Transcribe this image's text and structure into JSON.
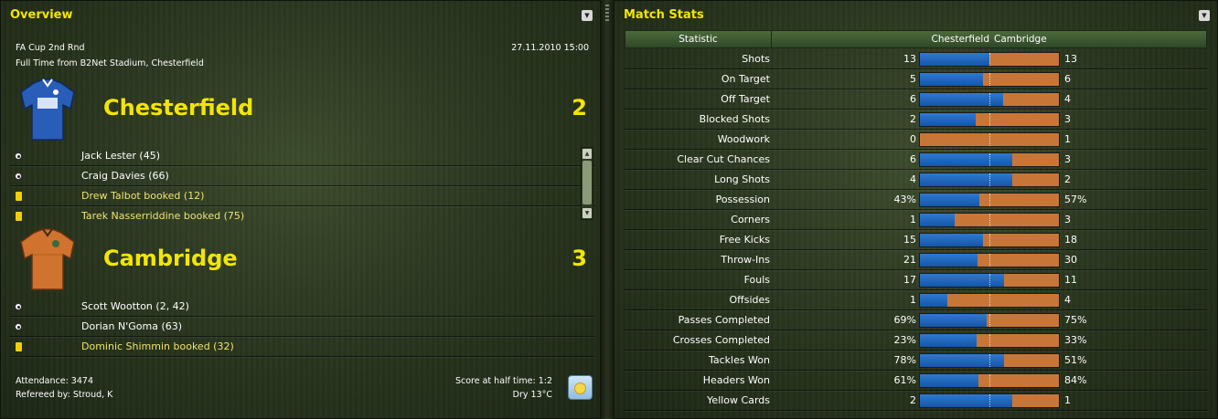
{
  "overview": {
    "title": "Overview",
    "competition": "FA Cup 2nd Rnd",
    "datetime": "27.11.2010 15:00",
    "venue_line": "Full Time from B2Net Stadium, Chesterfield",
    "home": {
      "name": "Chesterfield",
      "score": "2",
      "kit_color": "#2a5db8",
      "events": [
        {
          "type": "goal",
          "icon": "ball-icon",
          "text": "Jack Lester (45)"
        },
        {
          "type": "goal",
          "icon": "ball-icon",
          "text": "Craig Davies (66)"
        },
        {
          "type": "booking",
          "icon": "yellow-card-icon",
          "text": "Drew Talbot booked (12)"
        },
        {
          "type": "booking",
          "icon": "yellow-card-icon",
          "text": "Tarek Nasserriddine booked (75)"
        }
      ]
    },
    "away": {
      "name": "Cambridge",
      "score": "3",
      "kit_color": "#d0732e",
      "events": [
        {
          "type": "goal",
          "icon": "ball-icon",
          "text": "Scott Wootton (2, 42)"
        },
        {
          "type": "goal",
          "icon": "ball-icon",
          "text": "Dorian N'Goma (63)"
        },
        {
          "type": "booking",
          "icon": "yellow-card-icon",
          "text": "Dominic Shimmin booked (32)"
        }
      ]
    },
    "attendance": "Attendance: 3474",
    "referee": "Refereed by: Stroud, K",
    "halftime": "Score at half time: 1:2",
    "weather": "Dry 13°C",
    "weather_icon": "sun-icon"
  },
  "stats": {
    "title": "Match Stats",
    "columns": {
      "statistic": "Statistic",
      "home": "Chesterfield",
      "away": "Cambridge"
    },
    "colors": {
      "home": "#1e63be",
      "away": "#c87637"
    },
    "rows": [
      {
        "label": "Shots",
        "home": "13",
        "away": "13",
        "home_share": 0.5
      },
      {
        "label": "On Target",
        "home": "5",
        "away": "6",
        "home_share": 0.455
      },
      {
        "label": "Off Target",
        "home": "6",
        "away": "4",
        "home_share": 0.6
      },
      {
        "label": "Blocked Shots",
        "home": "2",
        "away": "3",
        "home_share": 0.4
      },
      {
        "label": "Woodwork",
        "home": "0",
        "away": "1",
        "home_share": 0.0
      },
      {
        "label": "Clear Cut Chances",
        "home": "6",
        "away": "3",
        "home_share": 0.667
      },
      {
        "label": "Long Shots",
        "home": "4",
        "away": "2",
        "home_share": 0.667
      },
      {
        "label": "Possession",
        "home": "43%",
        "away": "57%",
        "home_share": 0.43
      },
      {
        "label": "Corners",
        "home": "1",
        "away": "3",
        "home_share": 0.25
      },
      {
        "label": "Free Kicks",
        "home": "15",
        "away": "18",
        "home_share": 0.455
      },
      {
        "label": "Throw-Ins",
        "home": "21",
        "away": "30",
        "home_share": 0.412
      },
      {
        "label": "Fouls",
        "home": "17",
        "away": "11",
        "home_share": 0.607
      },
      {
        "label": "Offsides",
        "home": "1",
        "away": "4",
        "home_share": 0.2
      },
      {
        "label": "Passes Completed",
        "home": "69%",
        "away": "75%",
        "home_share": 0.479
      },
      {
        "label": "Crosses Completed",
        "home": "23%",
        "away": "33%",
        "home_share": 0.411
      },
      {
        "label": "Tackles Won",
        "home": "78%",
        "away": "51%",
        "home_share": 0.605
      },
      {
        "label": "Headers Won",
        "home": "61%",
        "away": "84%",
        "home_share": 0.421
      },
      {
        "label": "Yellow Cards",
        "home": "2",
        "away": "1",
        "home_share": 0.667
      }
    ]
  }
}
